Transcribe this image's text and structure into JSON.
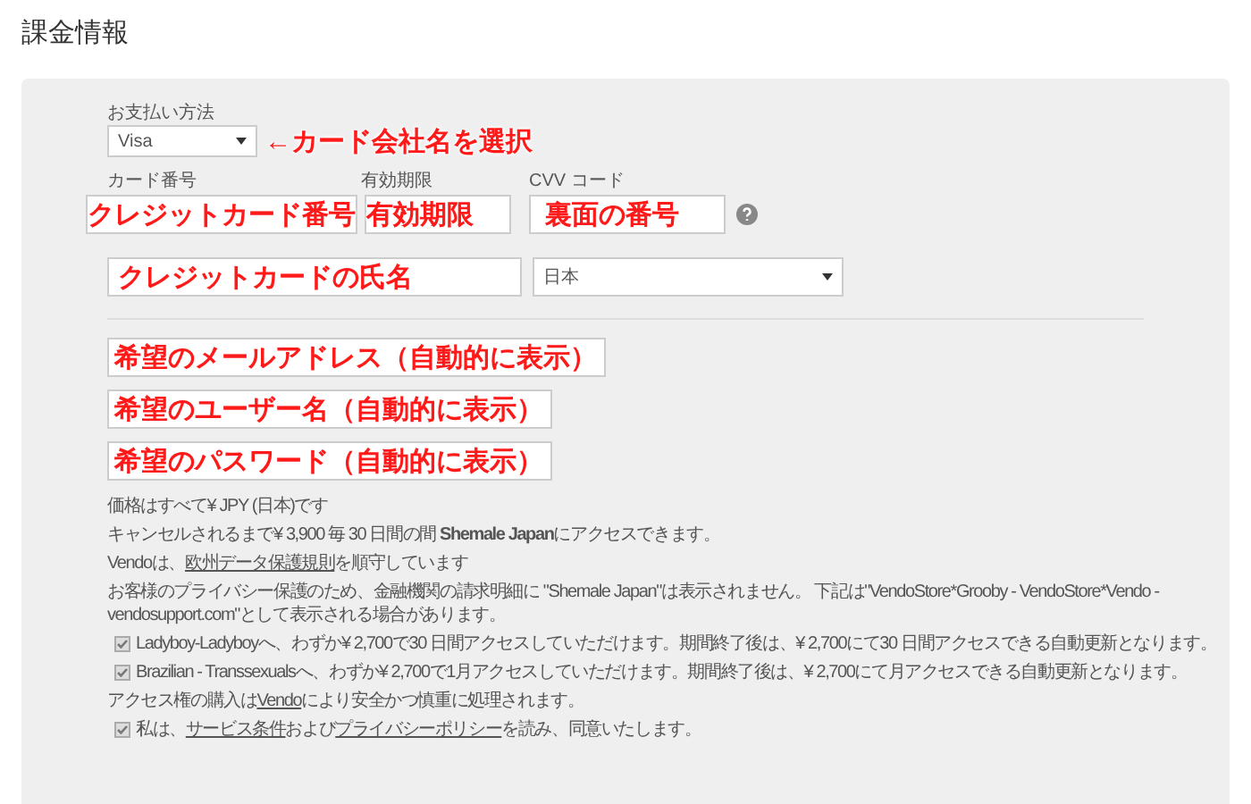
{
  "title": "課金情報",
  "payment_method": {
    "label": "お支払い方法",
    "value": "Visa",
    "note": "←カード会社名を選択"
  },
  "card_number": {
    "label": "カード番号",
    "note": "クレジットカード番号"
  },
  "expiry": {
    "label": "有効期限",
    "note": "有効期限"
  },
  "cvv": {
    "label": "CVV コード",
    "note": "裏面の番号"
  },
  "name": {
    "note": "クレジットカードの氏名"
  },
  "country": {
    "value": "日本"
  },
  "account_fields": [
    {
      "note": "希望のメールアドレス（自動的に表示）"
    },
    {
      "note": "希望のユーザー名（自動的に表示）"
    },
    {
      "note": "希望のパスワード（自動的に表示）"
    }
  ],
  "lines": [
    {
      "kind": "text",
      "parts": [
        {
          "text": "価格はすべて¥ JPY (日本)です",
          "link": false
        }
      ]
    },
    {
      "kind": "text",
      "parts": [
        {
          "text": "キャンセルされるまで¥ 3,900 毎 30 日間の間 **Shemale Japan**にアクセスできます。",
          "link": false
        }
      ]
    },
    {
      "kind": "text",
      "parts": [
        {
          "text": "Vendoは、",
          "link": false
        },
        {
          "text": "欧州データ保護規則",
          "link": true
        },
        {
          "text": "を順守しています",
          "link": false
        }
      ]
    },
    {
      "kind": "text",
      "parts": [
        {
          "text": "お客様のプライバシー保護のため、金融機関の請求明細に \"Shemale Japan\"は表示されません。 下記は\"VendoStore*Grooby - VendoStore*Vendo - vendosupport.com\"として表示される場合があります。",
          "link": false
        }
      ]
    },
    {
      "kind": "checkbox",
      "checked": true,
      "parts": [
        {
          "text": "Ladyboy-Ladyboyへ、わずか¥ 2,700で30 日間アクセスしていただけます。期間終了後は、¥ 2,700にて30 日間アクセスできる自動更新となります。",
          "link": false
        }
      ]
    },
    {
      "kind": "checkbox",
      "checked": true,
      "parts": [
        {
          "text": "Brazilian - Transsexualsへ、わずか¥ 2,700で1月アクセスしていただけます。期間終了後は、¥ 2,700にて月アクセスできる自動更新となります。",
          "link": false
        }
      ]
    },
    {
      "kind": "text",
      "parts": [
        {
          "text": "アクセス権の購入は",
          "link": false
        },
        {
          "text": "Vendo",
          "link": true
        },
        {
          "text": "により安全かつ慎重に処理されます。",
          "link": false
        }
      ]
    },
    {
      "kind": "checkbox",
      "checked": true,
      "parts": [
        {
          "text": "私は、",
          "link": false
        },
        {
          "text": "サービス条件",
          "link": true
        },
        {
          "text": "および",
          "link": false
        },
        {
          "text": "プライバシーポリシー",
          "link": true
        },
        {
          "text": "を読み、同意いたします。",
          "link": false
        }
      ]
    }
  ]
}
